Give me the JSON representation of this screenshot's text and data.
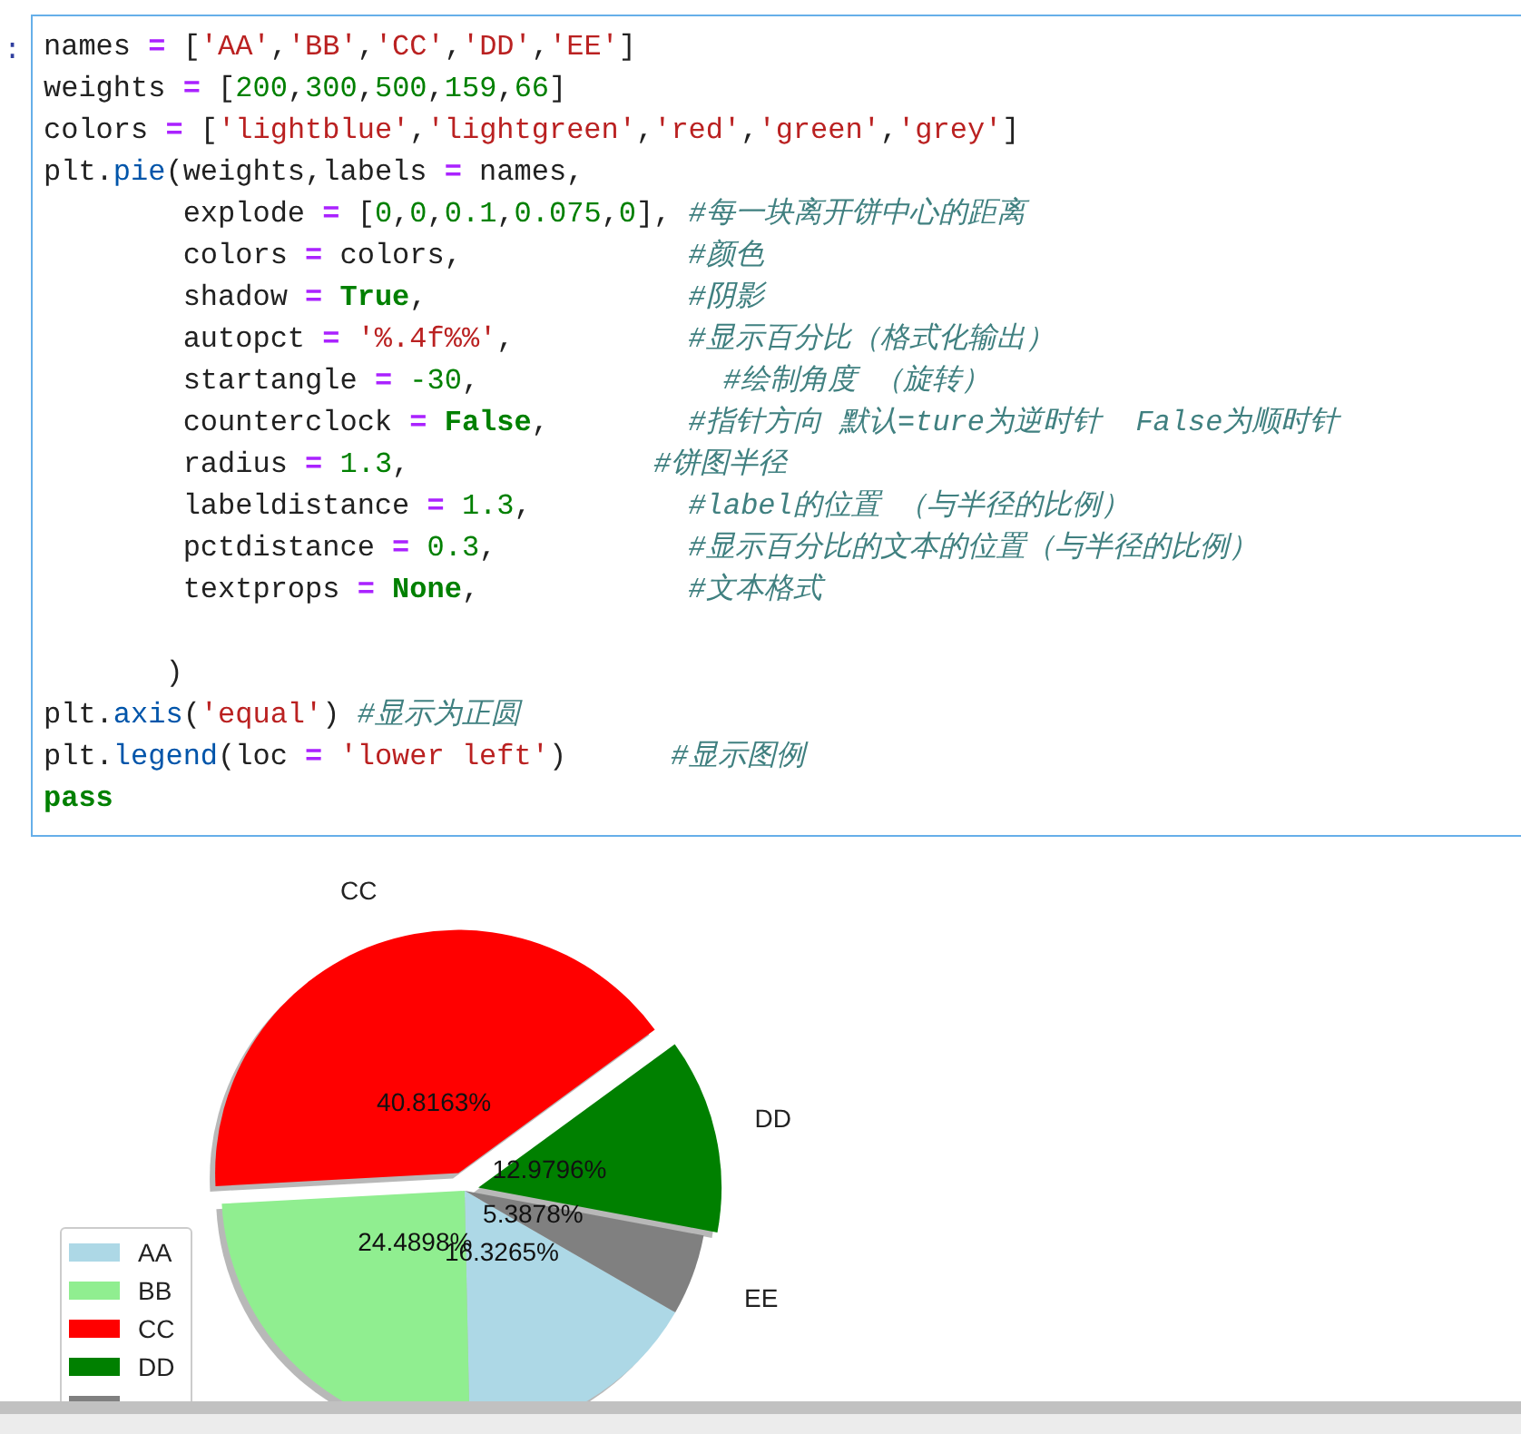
{
  "code_cell": {
    "prompt": ":",
    "lines": [
      {
        "tokens": [
          {
            "kind": "n",
            "text": "names "
          },
          {
            "kind": "o",
            "text": "= "
          },
          {
            "kind": "n",
            "text": "["
          },
          {
            "kind": "s",
            "text": "'AA'"
          },
          {
            "kind": "n",
            "text": ","
          },
          {
            "kind": "s",
            "text": "'BB'"
          },
          {
            "kind": "n",
            "text": ","
          },
          {
            "kind": "s",
            "text": "'CC'"
          },
          {
            "kind": "n",
            "text": ","
          },
          {
            "kind": "s",
            "text": "'DD'"
          },
          {
            "kind": "n",
            "text": ","
          },
          {
            "kind": "s",
            "text": "'EE'"
          },
          {
            "kind": "n",
            "text": "]"
          }
        ]
      },
      {
        "tokens": [
          {
            "kind": "n",
            "text": "weights "
          },
          {
            "kind": "o",
            "text": "= "
          },
          {
            "kind": "n",
            "text": "["
          },
          {
            "kind": "m",
            "text": "200"
          },
          {
            "kind": "n",
            "text": ","
          },
          {
            "kind": "m",
            "text": "300"
          },
          {
            "kind": "n",
            "text": ","
          },
          {
            "kind": "m",
            "text": "500"
          },
          {
            "kind": "n",
            "text": ","
          },
          {
            "kind": "m",
            "text": "159"
          },
          {
            "kind": "n",
            "text": ","
          },
          {
            "kind": "m",
            "text": "66"
          },
          {
            "kind": "n",
            "text": "]"
          }
        ]
      },
      {
        "tokens": [
          {
            "kind": "n",
            "text": "colors "
          },
          {
            "kind": "o",
            "text": "= "
          },
          {
            "kind": "n",
            "text": "["
          },
          {
            "kind": "s",
            "text": "'lightblue'"
          },
          {
            "kind": "n",
            "text": ","
          },
          {
            "kind": "s",
            "text": "'lightgreen'"
          },
          {
            "kind": "n",
            "text": ","
          },
          {
            "kind": "s",
            "text": "'red'"
          },
          {
            "kind": "n",
            "text": ","
          },
          {
            "kind": "s",
            "text": "'green'"
          },
          {
            "kind": "n",
            "text": ","
          },
          {
            "kind": "s",
            "text": "'grey'"
          },
          {
            "kind": "n",
            "text": "]"
          }
        ]
      },
      {
        "tokens": [
          {
            "kind": "n",
            "text": "plt."
          },
          {
            "kind": "f",
            "text": "pie"
          },
          {
            "kind": "n",
            "text": "(weights,labels "
          },
          {
            "kind": "o",
            "text": "= "
          },
          {
            "kind": "n",
            "text": "names,"
          }
        ]
      },
      {
        "tokens": [
          {
            "kind": "n",
            "text": "        explode "
          },
          {
            "kind": "o",
            "text": "= "
          },
          {
            "kind": "n",
            "text": "["
          },
          {
            "kind": "m",
            "text": "0"
          },
          {
            "kind": "n",
            "text": ","
          },
          {
            "kind": "m",
            "text": "0"
          },
          {
            "kind": "n",
            "text": ","
          },
          {
            "kind": "m",
            "text": "0.1"
          },
          {
            "kind": "n",
            "text": ","
          },
          {
            "kind": "m",
            "text": "0.075"
          },
          {
            "kind": "n",
            "text": ","
          },
          {
            "kind": "m",
            "text": "0"
          },
          {
            "kind": "n",
            "text": "], "
          },
          {
            "kind": "c",
            "text": "#每一块离开饼中心的距离"
          }
        ]
      },
      {
        "tokens": [
          {
            "kind": "n",
            "text": "        colors "
          },
          {
            "kind": "o",
            "text": "= "
          },
          {
            "kind": "n",
            "text": "colors,             "
          },
          {
            "kind": "c",
            "text": "#颜色"
          }
        ]
      },
      {
        "tokens": [
          {
            "kind": "n",
            "text": "        shadow "
          },
          {
            "kind": "o",
            "text": "= "
          },
          {
            "kind": "k",
            "text": "True"
          },
          {
            "kind": "n",
            "text": ",               "
          },
          {
            "kind": "c",
            "text": "#阴影"
          }
        ]
      },
      {
        "tokens": [
          {
            "kind": "n",
            "text": "        autopct "
          },
          {
            "kind": "o",
            "text": "= "
          },
          {
            "kind": "s",
            "text": "'%.4f%%'"
          },
          {
            "kind": "n",
            "text": ",          "
          },
          {
            "kind": "c",
            "text": "#显示百分比（格式化输出）"
          }
        ]
      },
      {
        "tokens": [
          {
            "kind": "n",
            "text": "        startangle "
          },
          {
            "kind": "o",
            "text": "= "
          },
          {
            "kind": "m",
            "text": "-30"
          },
          {
            "kind": "n",
            "text": ",              "
          },
          {
            "kind": "c",
            "text": "#绘制角度 （旋转）"
          }
        ]
      },
      {
        "tokens": [
          {
            "kind": "n",
            "text": "        counterclock "
          },
          {
            "kind": "o",
            "text": "= "
          },
          {
            "kind": "k",
            "text": "False"
          },
          {
            "kind": "n",
            "text": ",        "
          },
          {
            "kind": "c",
            "text": "#指针方向 默认=ture为逆时针  False为顺时针"
          }
        ]
      },
      {
        "tokens": [
          {
            "kind": "n",
            "text": "        radius "
          },
          {
            "kind": "o",
            "text": "= "
          },
          {
            "kind": "m",
            "text": "1.3"
          },
          {
            "kind": "n",
            "text": ",              "
          },
          {
            "kind": "c",
            "text": "#饼图半径"
          }
        ]
      },
      {
        "tokens": [
          {
            "kind": "n",
            "text": "        labeldistance "
          },
          {
            "kind": "o",
            "text": "= "
          },
          {
            "kind": "m",
            "text": "1.3"
          },
          {
            "kind": "n",
            "text": ",         "
          },
          {
            "kind": "c",
            "text": "#label的位置 （与半径的比例）"
          }
        ]
      },
      {
        "tokens": [
          {
            "kind": "n",
            "text": "        pctdistance "
          },
          {
            "kind": "o",
            "text": "= "
          },
          {
            "kind": "m",
            "text": "0.3"
          },
          {
            "kind": "n",
            "text": ",           "
          },
          {
            "kind": "c",
            "text": "#显示百分比的文本的位置（与半径的比例）"
          }
        ]
      },
      {
        "tokens": [
          {
            "kind": "n",
            "text": "        textprops "
          },
          {
            "kind": "o",
            "text": "= "
          },
          {
            "kind": "k",
            "text": "None"
          },
          {
            "kind": "n",
            "text": ",            "
          },
          {
            "kind": "c",
            "text": "#文本格式"
          }
        ]
      },
      {
        "tokens": [
          {
            "kind": "n",
            "text": "\n       )"
          }
        ]
      },
      {
        "tokens": [
          {
            "kind": "n",
            "text": "plt."
          },
          {
            "kind": "f",
            "text": "axis"
          },
          {
            "kind": "n",
            "text": "("
          },
          {
            "kind": "s",
            "text": "'equal'"
          },
          {
            "kind": "n",
            "text": ") "
          },
          {
            "kind": "c",
            "text": "#显示为正圆"
          }
        ]
      },
      {
        "tokens": [
          {
            "kind": "n",
            "text": "plt."
          },
          {
            "kind": "f",
            "text": "legend"
          },
          {
            "kind": "n",
            "text": "(loc "
          },
          {
            "kind": "o",
            "text": "= "
          },
          {
            "kind": "s",
            "text": "'lower left'"
          },
          {
            "kind": "n",
            "text": ")      "
          },
          {
            "kind": "c",
            "text": "#显示图例"
          }
        ]
      },
      {
        "tokens": [
          {
            "kind": "k",
            "text": "pass"
          }
        ]
      }
    ]
  },
  "output": {
    "chart_data": {
      "type": "pie",
      "categories": [
        "AA",
        "BB",
        "CC",
        "DD",
        "EE"
      ],
      "values": [
        16.3265,
        24.4898,
        40.8163,
        12.9796,
        5.3878
      ],
      "colors": [
        "#add8e6",
        "#90ee90",
        "#ff0000",
        "#008000",
        "#808080"
      ],
      "value_labels": [
        "16.3265%",
        "24.4898%",
        "40.8163%",
        "12.9796%",
        "5.3878%"
      ]
    }
  }
}
